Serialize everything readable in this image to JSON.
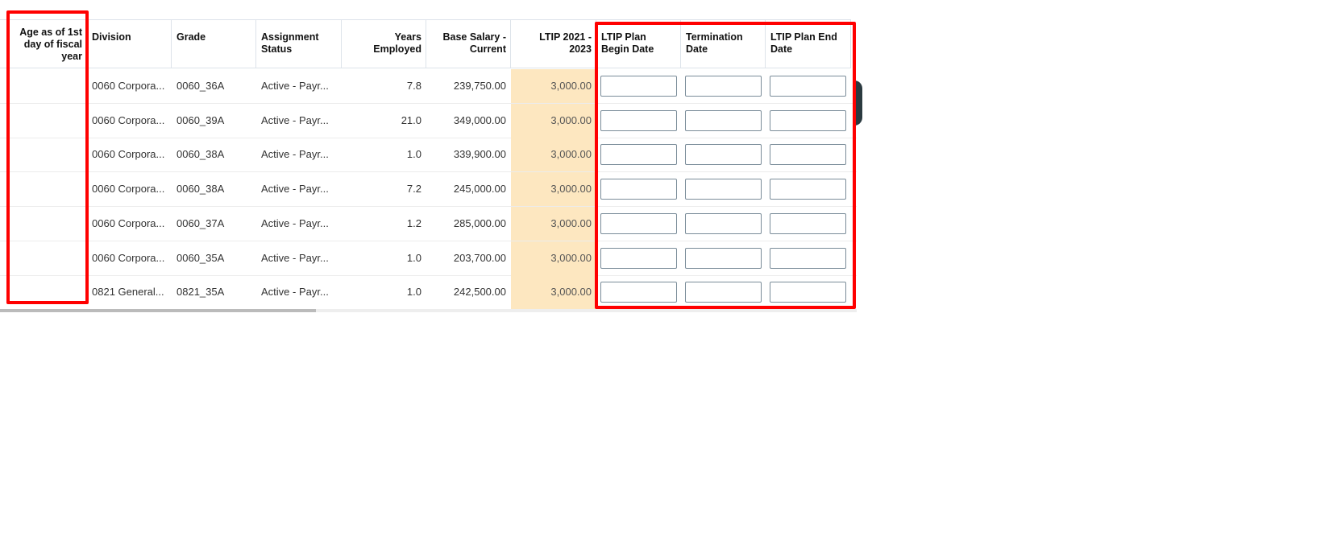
{
  "columns": [
    "Age as of 1st day of fiscal year",
    "Division",
    "Grade",
    "Assignment Status",
    "Years Employed",
    "Base Salary - Current",
    "LTIP 2021 - 2023",
    "LTIP Plan Begin Date",
    "Termination Date",
    "LTIP Plan End Date"
  ],
  "rows": [
    {
      "age": "",
      "division": "0060 Corpora...",
      "grade": "0060_36A",
      "status": "Active - Payr...",
      "years": "7.8",
      "salary": "239,750.00",
      "ltip": "3,000.00",
      "begin": "",
      "term": "",
      "end": ""
    },
    {
      "age": "",
      "division": "0060 Corpora...",
      "grade": "0060_39A",
      "status": "Active - Payr...",
      "years": "21.0",
      "salary": "349,000.00",
      "ltip": "3,000.00",
      "begin": "",
      "term": "",
      "end": ""
    },
    {
      "age": "",
      "division": "0060 Corpora...",
      "grade": "0060_38A",
      "status": "Active - Payr...",
      "years": "1.0",
      "salary": "339,900.00",
      "ltip": "3,000.00",
      "begin": "",
      "term": "",
      "end": ""
    },
    {
      "age": "",
      "division": "0060 Corpora...",
      "grade": "0060_38A",
      "status": "Active - Payr...",
      "years": "7.2",
      "salary": "245,000.00",
      "ltip": "3,000.00",
      "begin": "",
      "term": "",
      "end": ""
    },
    {
      "age": "",
      "division": "0060 Corpora...",
      "grade": "0060_37A",
      "status": "Active - Payr...",
      "years": "1.2",
      "salary": "285,000.00",
      "ltip": "3,000.00",
      "begin": "",
      "term": "",
      "end": ""
    },
    {
      "age": "",
      "division": "0060 Corpora...",
      "grade": "0060_35A",
      "status": "Active - Payr...",
      "years": "1.0",
      "salary": "203,700.00",
      "ltip": "3,000.00",
      "begin": "",
      "term": "",
      "end": ""
    },
    {
      "age": "",
      "division": "0821 General...",
      "grade": "0821_35A",
      "status": "Active - Payr...",
      "years": "1.0",
      "salary": "242,500.00",
      "ltip": "3,000.00",
      "begin": "",
      "term": "",
      "end": ""
    }
  ],
  "colors": {
    "highlight": "#ff0000",
    "ltip_bg": "#fde7c0"
  }
}
